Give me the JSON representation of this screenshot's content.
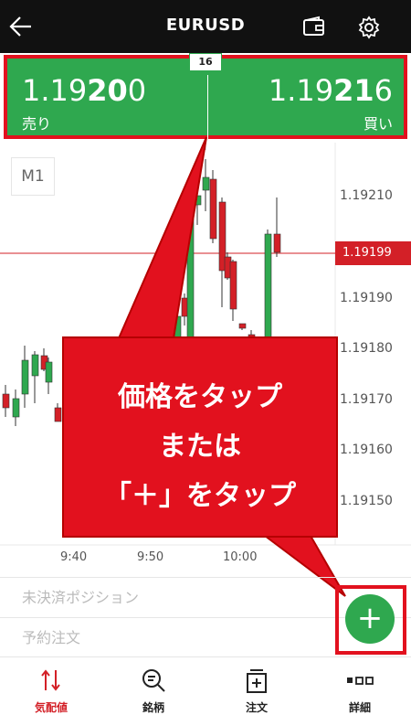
{
  "header": {
    "title": "EURUSD",
    "back_icon": "back-arrow-icon",
    "wallet_icon": "wallet-icon",
    "settings_icon": "gear-icon"
  },
  "quote": {
    "spread": "16",
    "sell": {
      "prefix": "1.19",
      "bold": "20",
      "suffix": "0",
      "label": "売り"
    },
    "buy": {
      "prefix": "1.19",
      "bold": "21",
      "suffix": "6",
      "label": "買い"
    },
    "colors": {
      "panel": "#2fa84f",
      "highlight": "#e2111e"
    }
  },
  "chart": {
    "timeframe": "M1",
    "y_labels": [
      "1.19210",
      "1.19190",
      "1.19180",
      "1.19170",
      "1.19160",
      "1.19150"
    ],
    "current_price": "1.19199",
    "x_labels": [
      "9:40",
      "9:50",
      "10:00"
    ],
    "colors": {
      "up": "#2fa84f",
      "down": "#d32027",
      "current": "#d32027"
    }
  },
  "callout": {
    "line1": "価格をタップ",
    "line2": "または",
    "line3": "「＋」をタップ"
  },
  "sections": {
    "positions": "未決済ポジション",
    "orders": "予約注文"
  },
  "fab": {
    "label": "+"
  },
  "nav": [
    {
      "label": "気配値",
      "icon": "quotes-icon",
      "active": true
    },
    {
      "label": "銘柄",
      "icon": "search-icon",
      "active": false
    },
    {
      "label": "注文",
      "icon": "order-icon",
      "active": false
    },
    {
      "label": "詳細",
      "icon": "more-icon",
      "active": false
    }
  ]
}
